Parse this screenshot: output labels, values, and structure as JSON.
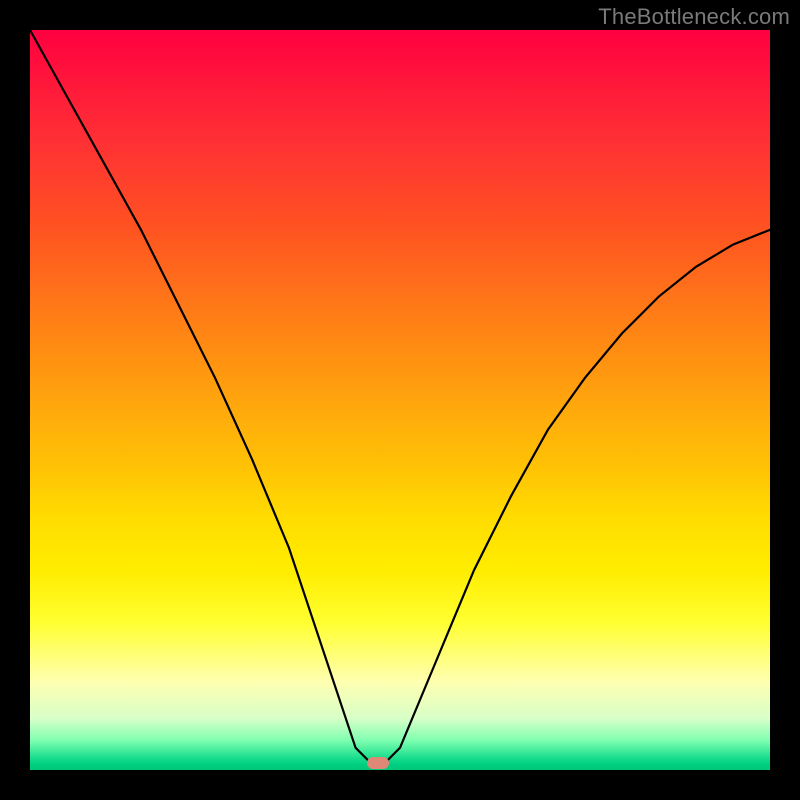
{
  "watermark": "TheBottleneck.com",
  "chart_data": {
    "type": "line",
    "title": "",
    "xlabel": "",
    "ylabel": "",
    "xlim": [
      0,
      100
    ],
    "ylim": [
      0,
      100
    ],
    "grid": false,
    "legend": false,
    "background_gradient": {
      "orientation": "vertical",
      "stops": [
        {
          "pos": 0,
          "color": "#ff0040"
        },
        {
          "pos": 0.25,
          "color": "#ff5522"
        },
        {
          "pos": 0.5,
          "color": "#ffa80c"
        },
        {
          "pos": 0.75,
          "color": "#ffee00"
        },
        {
          "pos": 0.93,
          "color": "#d8ffc8"
        },
        {
          "pos": 1.0,
          "color": "#00c878"
        }
      ]
    },
    "series": [
      {
        "name": "bottleneck-curve",
        "color": "#000000",
        "x": [
          0,
          5,
          10,
          15,
          20,
          25,
          30,
          35,
          40,
          44,
          46,
          48,
          50,
          55,
          60,
          65,
          70,
          75,
          80,
          85,
          90,
          95,
          100
        ],
        "y": [
          100,
          91,
          82,
          73,
          63,
          53,
          42,
          30,
          15,
          3,
          1,
          1,
          3,
          15,
          27,
          37,
          46,
          53,
          59,
          64,
          68,
          71,
          73
        ]
      }
    ],
    "marker": {
      "name": "optimal-point",
      "x": 47,
      "y": 1,
      "color": "#e08878",
      "shape": "pill"
    }
  }
}
